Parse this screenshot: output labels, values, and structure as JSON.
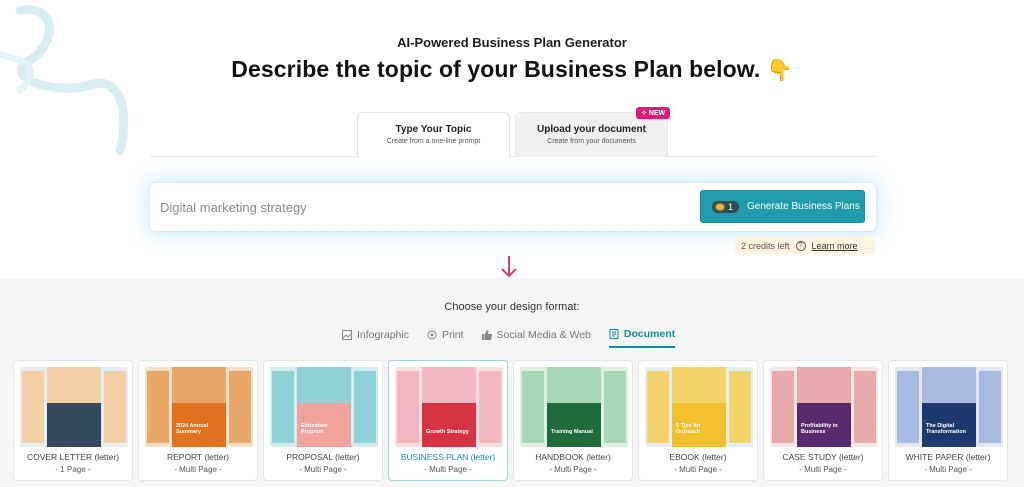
{
  "header": {
    "subtitle": "AI-Powered Business Plan Generator",
    "title": "Describe the topic of your Business Plan below.",
    "emoji": "👇"
  },
  "tabs": [
    {
      "title": "Type Your Topic",
      "subtitle": "Create from a one-line prompt",
      "active": true
    },
    {
      "title": "Upload your document",
      "subtitle": "Create from your documents",
      "active": false,
      "badge": "NEW"
    }
  ],
  "search": {
    "placeholder": "Digital marketing strategy",
    "value": ""
  },
  "generate_button": {
    "credits": "1",
    "label": "Generate Business Plans"
  },
  "credits_note": {
    "text": "2 credits left",
    "link": "Learn more"
  },
  "design": {
    "prompt": "Choose your design format:",
    "formats": [
      {
        "label": "Infographic",
        "icon": "image-icon",
        "active": false
      },
      {
        "label": "Print",
        "icon": "print-icon",
        "active": false
      },
      {
        "label": "Social Media & Web",
        "icon": "thumbs-up-icon",
        "active": false
      },
      {
        "label": "Document",
        "icon": "document-icon",
        "active": true
      }
    ],
    "cards": [
      {
        "name": "COVER LETTER (letter)",
        "pages": "- 1 Page -",
        "cover_text": "",
        "bg": "#e9ecef",
        "accent": "#34495e",
        "side": "#f2d1a7"
      },
      {
        "name": "REPORT (letter)",
        "pages": "- Multi Page -",
        "cover_text": "2024 Annual Summary",
        "bg": "#f3e1c5",
        "accent": "#e2711d",
        "side": "#e8a76b"
      },
      {
        "name": "PROPOSAL (letter)",
        "pages": "- Multi Page -",
        "cover_text": "Education Program",
        "bg": "#d4ecef",
        "accent": "#f0a39a",
        "side": "#8fd1d6"
      },
      {
        "name": "BUSINESS PLAN (letter)",
        "pages": "- Multi Page -",
        "cover_text": "Growth Strategy",
        "bg": "#fbe0e2",
        "accent": "#d63343",
        "side": "#f4b7bf"
      },
      {
        "name": "HANDBOOK (letter)",
        "pages": "- Multi Page -",
        "cover_text": "Training Manual",
        "bg": "#dff0e3",
        "accent": "#1f6b3a",
        "side": "#a8d9b6"
      },
      {
        "name": "EBOOK (letter)",
        "pages": "- Multi Page -",
        "cover_text": "5 Tips for Outreach",
        "bg": "#e5eef8",
        "accent": "#f2c12e",
        "side": "#f1d56a"
      },
      {
        "name": "CASE STUDY (letter)",
        "pages": "- Multi Page -",
        "cover_text": "Profitability in Business",
        "bg": "#f6e6e6",
        "accent": "#5b2a6e",
        "side": "#e7a9a9"
      },
      {
        "name": "WHITE PAPER (letter)",
        "pages": "- Multi Page -",
        "cover_text": "The Digital Transformation",
        "bg": "#e3e9f4",
        "accent": "#1c3a6e",
        "side": "#a7bbe0"
      }
    ],
    "selected_index": 3
  },
  "colors": {
    "accent": "#1f9bab",
    "badge": "#e4167a",
    "arrow": "#d63a7a"
  }
}
